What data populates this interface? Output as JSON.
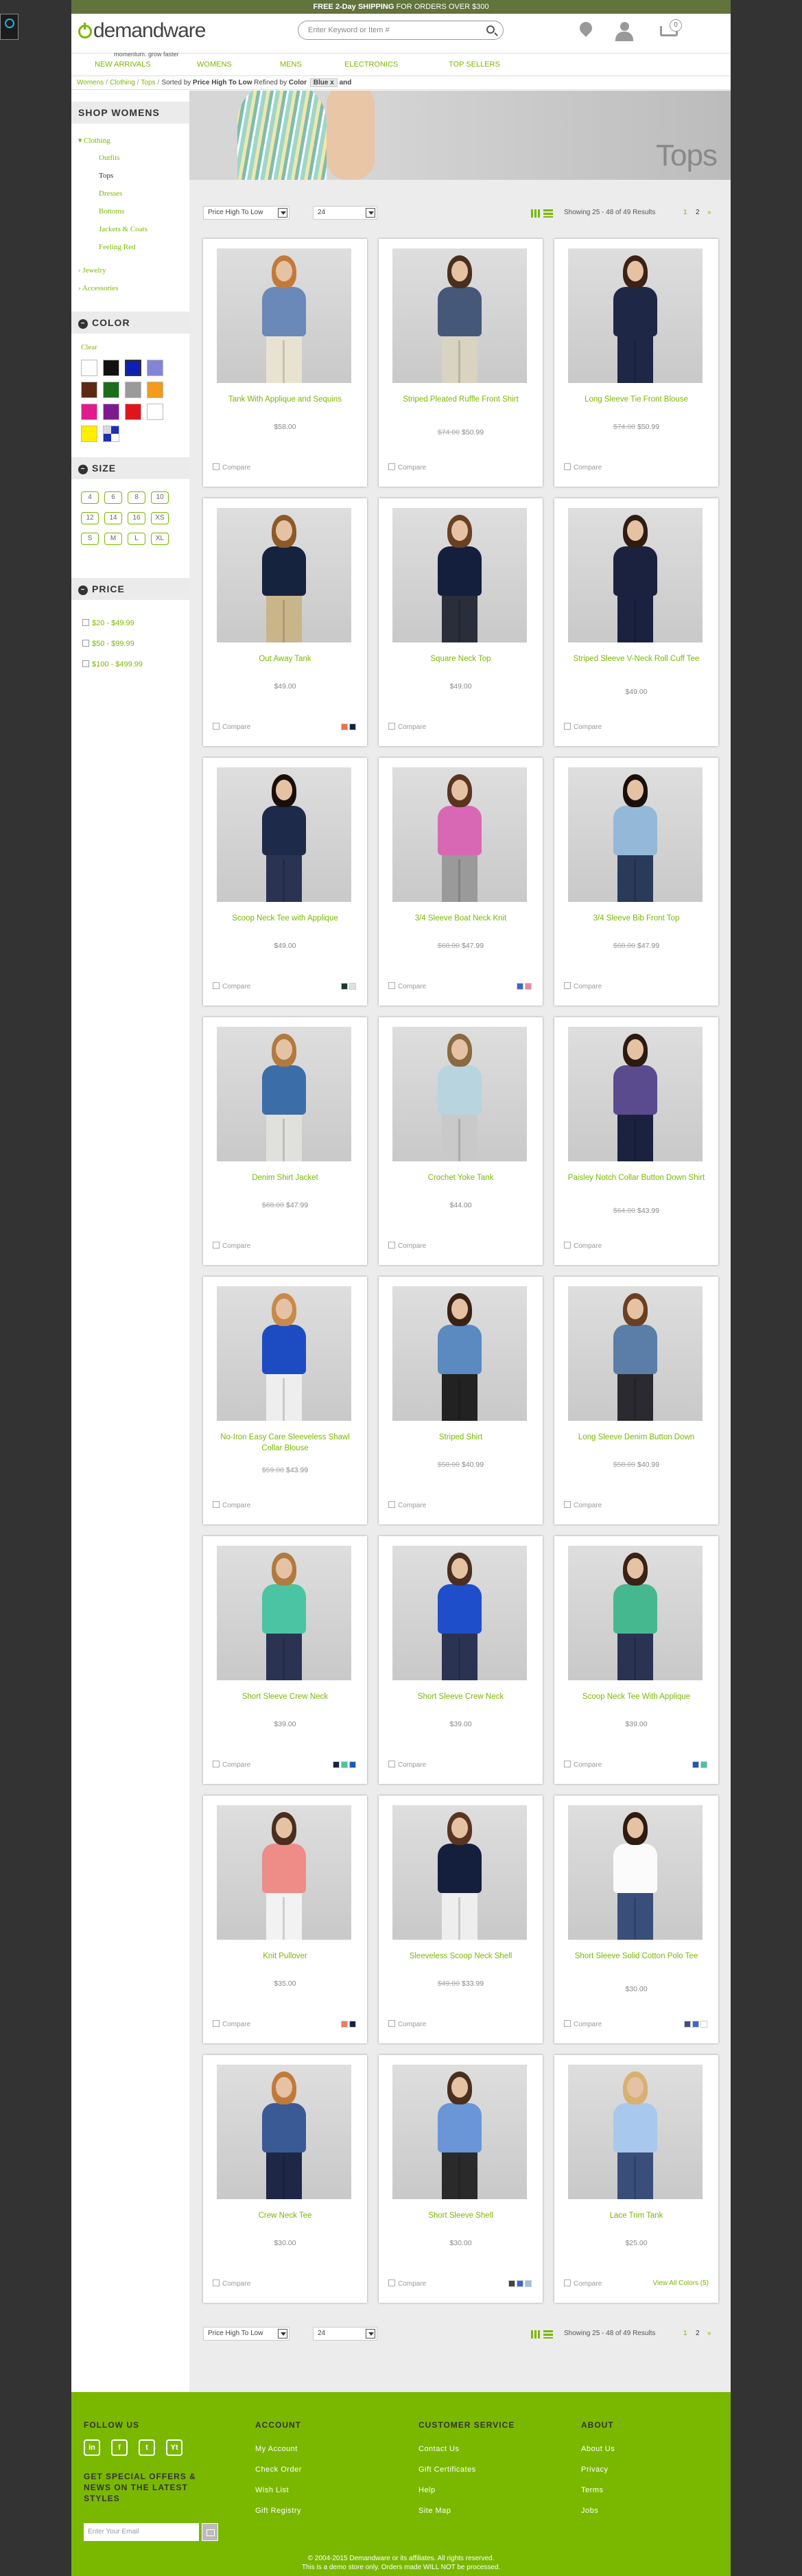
{
  "promo": {
    "bold": "FREE 2-Day SHIPPING",
    "rest": " FOR ORDERS OVER $300"
  },
  "header": {
    "logo": "demandware",
    "tagline": "momentum. grow faster",
    "search_placeholder": "Enter Keyword or Item #",
    "cart_count": "0"
  },
  "nav": [
    "NEW ARRIVALS",
    "WOMENS",
    "MENS",
    "ELECTRONICS",
    "TOP SELLERS"
  ],
  "breadcrumb": {
    "items": [
      "Womens",
      "Clothing",
      "Tops"
    ],
    "sorted_prefix": "Sorted by ",
    "sorted_value": "Price High To Low",
    "refined_prefix": " Refined by ",
    "refined_label": "Color",
    "chip": "Blue",
    "chip_x": "x",
    "and": "and"
  },
  "sidebar": {
    "title": "SHOP WOMENS",
    "clothing": "Clothing",
    "clothing_items": [
      "Outfits",
      "Tops",
      "Dresses",
      "Bottoms",
      "Jackets & Coats",
      "Feeling Red"
    ],
    "jewelry": "Jewelry",
    "accessories": "Accessories",
    "color_title": "COLOR",
    "clear": "Clear",
    "colors": [
      "#ffffff",
      "#111111",
      "#0d1fb5",
      "#8484d6",
      "#5c2a12",
      "#1a6e1a",
      "#9a9a9a",
      "#f39b1a",
      "#e11b8c",
      "#7d1a8f",
      "#e0141b",
      "#ffffff",
      "#ffee00",
      "miscellaneous"
    ],
    "size_title": "SIZE",
    "sizes": [
      "4",
      "6",
      "8",
      "10",
      "12",
      "14",
      "16",
      "XS",
      "S",
      "M",
      "L",
      "XL"
    ],
    "price_title": "PRICE",
    "prices": [
      "$20 - $49.99",
      "$50 - $99.99",
      "$100 - $499.99"
    ]
  },
  "banner": {
    "title": "Tops"
  },
  "toolbar": {
    "sort": "Price High To Low",
    "per_page": "24",
    "showing": "Showing 25 - 48 of 49 Results",
    "pages": [
      "1",
      "2"
    ],
    "next": "»"
  },
  "products": [
    {
      "name": "Tank With Applique and Sequins",
      "price": "$58.00",
      "old": "",
      "compare": "Compare",
      "swatches": [],
      "top": "#6a88b8",
      "bottom": "#e8e2d0",
      "hair": "#c27a3a"
    },
    {
      "name": "Striped Pleated Ruffle Front Shirt",
      "price": "$50.99",
      "old": "$74.00",
      "compare": "Compare",
      "swatches": [],
      "top": "#46587a",
      "bottom": "#d9d3c2",
      "hair": "#4a2f1e"
    },
    {
      "name": "Long Sleeve Tie Front Blouse",
      "price": "$50.99",
      "old": "$74.00",
      "compare": "Compare",
      "swatches": [],
      "top": "#1e2746",
      "bottom": "#1e2746",
      "hair": "#3a2214"
    },
    {
      "name": "Out Away Tank",
      "price": "$49.00",
      "old": "",
      "compare": "Compare",
      "swatches": [
        "#e8704a",
        "#16233e"
      ],
      "top": "#16233e",
      "bottom": "#c9b58a",
      "hair": "#8a5a2a"
    },
    {
      "name": "Square Neck Top",
      "price": "$49.00",
      "old": "",
      "compare": "Compare",
      "swatches": [],
      "top": "#141f3e",
      "bottom": "#2a2d3a",
      "hair": "#6a4022"
    },
    {
      "name": "Striped Sleeve V-Neck Roll Cuff Tee",
      "price": "$49.00",
      "old": "",
      "compare": "Compare",
      "swatches": [],
      "top": "#1b2240",
      "bottom": "#1b2240",
      "hair": "#2e1c10"
    },
    {
      "name": "Scoop Neck Tee with Applique",
      "price": "$49.00",
      "old": "",
      "compare": "Compare",
      "swatches": [
        "#1b3a2a",
        "#e0e0e0"
      ],
      "top": "#1e2a4a",
      "bottom": "#2a3452",
      "hair": "#1a0f08"
    },
    {
      "name": "3/4 Sleeve Boat Neck Knit",
      "price": "$47.99",
      "old": "$68.00",
      "compare": "Compare",
      "swatches": [
        "#3a67c9",
        "#e58aa0"
      ],
      "top": "#d968b4",
      "bottom": "#9a9a9a",
      "hair": "#5a3420"
    },
    {
      "name": "3/4 Sleeve Bib Front Top",
      "price": "$47.99",
      "old": "$68.00",
      "compare": "Compare",
      "swatches": [],
      "top": "#94b8d8",
      "bottom": "#2a3a5a",
      "hair": "#1a0f08"
    },
    {
      "name": "Denim Shirt Jacket",
      "price": "$47.99",
      "old": "$68.00",
      "compare": "Compare",
      "swatches": [],
      "top": "#3b6ea8",
      "bottom": "#e0e0dc",
      "hair": "#b07a40"
    },
    {
      "name": "Crochet Yoke Tank",
      "price": "$44.00",
      "old": "",
      "compare": "Compare",
      "swatches": [],
      "top": "#b8d4de",
      "bottom": "#c9c9c9",
      "hair": "#8a6a40"
    },
    {
      "name": "Paisley Notch Collar Button Down Shirt",
      "price": "$43.99",
      "old": "$64.00",
      "compare": "Compare",
      "swatches": [],
      "top": "#5a4a8e",
      "bottom": "#1b2240",
      "hair": "#2a1a10"
    },
    {
      "name": "No-Iron Easy Care Sleeveless Shawl Collar Blouse",
      "price": "$43.99",
      "old": "$59.00",
      "compare": "Compare",
      "swatches": [],
      "top": "#1d4bc2",
      "bottom": "#eeeeee",
      "hair": "#c88a4a"
    },
    {
      "name": "Striped Shirt",
      "price": "$40.99",
      "old": "$58.00",
      "compare": "Compare",
      "swatches": [],
      "top": "#5a8ac0",
      "bottom": "#222222",
      "hair": "#3a2214"
    },
    {
      "name": "Long Sleeve Denim Button Down",
      "price": "$40.99",
      "old": "$58.00",
      "compare": "Compare",
      "swatches": [],
      "top": "#5a7ea8",
      "bottom": "#2a2a30",
      "hair": "#6a4022"
    },
    {
      "name": "Short Sleeve Crew Neck",
      "price": "$39.00",
      "old": "",
      "compare": "Compare",
      "swatches": [
        "#1b2240",
        "#49c2a0",
        "#1a5ab5"
      ],
      "top": "#4ac4a2",
      "bottom": "#2a3452",
      "hair": "#b07a40"
    },
    {
      "name": "Short Sleeve Crew Neck",
      "price": "$39.00",
      "old": "",
      "compare": "Compare",
      "swatches": [],
      "top": "#1e4ec9",
      "bottom": "#2a3452",
      "hair": "#4a2f1e"
    },
    {
      "name": "Scoop Neck Tee With Applique",
      "price": "$39.00",
      "old": "",
      "compare": "Compare",
      "swatches": [
        "#1a5ab5",
        "#49c2a0"
      ],
      "top": "#46b890",
      "bottom": "#2a3452",
      "hair": "#3a2214"
    },
    {
      "name": "Knit Pullover",
      "price": "$35.00",
      "old": "",
      "compare": "Compare",
      "swatches": [
        "#e88060",
        "#1b2240"
      ],
      "top": "#ee8c88",
      "bottom": "#f2f2f2",
      "hair": "#4a2f1e"
    },
    {
      "name": "Sleeveless Scoop Neck Shell",
      "price": "$33.99",
      "old": "$49.00",
      "compare": "Compare",
      "swatches": [],
      "top": "#141f3e",
      "bottom": "#eeeeee",
      "hair": "#5a3420"
    },
    {
      "name": "Short Sleeve Solid Cotton Polo Tee",
      "price": "$30.00",
      "old": "",
      "compare": "Compare",
      "swatches": [
        "#44507a",
        "#3a67c9",
        "#ffffff"
      ],
      "top": "#fbfbfb",
      "bottom": "#3a4e7a",
      "hair": "#2e1c10"
    },
    {
      "name": "Crew Neck Tee",
      "price": "$30.00",
      "old": "",
      "compare": "Compare",
      "swatches": [],
      "top": "#3a5a96",
      "bottom": "#1e2746",
      "hair": "#c27a3a"
    },
    {
      "name": "Short Sleeve Shell",
      "price": "$30.00",
      "old": "",
      "compare": "Compare",
      "swatches": [
        "#444444",
        "#3a67c9",
        "#9ac0e8"
      ],
      "top": "#6a96d8",
      "bottom": "#2a2a2a",
      "hair": "#4a2f1e"
    },
    {
      "name": "Lace Trim Tank",
      "price": "$25.00",
      "old": "",
      "compare": "Compare",
      "swatches": [],
      "view_all": "View All Colors (5)",
      "top": "#a8c8ee",
      "bottom": "#3a4e7a",
      "hair": "#d8b070"
    }
  ],
  "footer": {
    "follow": "FOLLOW US",
    "social": [
      "in",
      "f",
      "t",
      "Yt"
    ],
    "newsletter": "GET SPECIAL OFFERS & NEWS ON THE LATEST STYLES",
    "email_placeholder": "Enter Your Email",
    "account_title": "ACCOUNT",
    "account": [
      "My Account",
      "Check Order",
      "Wish List",
      "Gift Registry"
    ],
    "service_title": "CUSTOMER SERVICE",
    "service": [
      "Contact Us",
      "Gift Certificates",
      "Help",
      "Site Map"
    ],
    "about_title": "ABOUT",
    "about": [
      "About Us",
      "Privacy",
      "Terms",
      "Jobs"
    ],
    "copy1": "© 2004-2015 Demandware or its affiliates. All rights reserved.",
    "copy2": "This is a demo store only. Orders made WILL NOT be processed."
  }
}
